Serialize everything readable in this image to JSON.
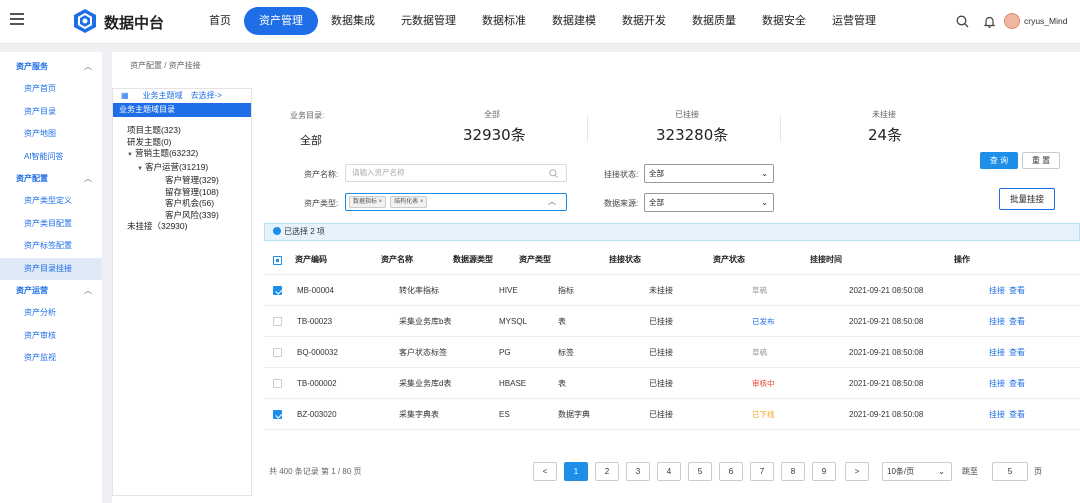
{
  "brand": "数据中台",
  "nav": [
    "首页",
    "资产管理",
    "数据集成",
    "元数据管理",
    "数据标准",
    "数据建模",
    "数据开发",
    "数据质量",
    "数据安全",
    "运营管理"
  ],
  "active_nav": 1,
  "user": "cryus_Mind",
  "sidebar": {
    "groups": [
      {
        "label": "资产服务",
        "items": [
          "资产首页",
          "资产目录",
          "资产地图",
          "AI智能问答"
        ]
      },
      {
        "label": "资产配置",
        "items": [
          "资产类型定义",
          "资产类目配置",
          "资产标签配置",
          "资产目录挂接"
        ]
      },
      {
        "label": "资产运营",
        "items": [
          "资产分析",
          "资产审核",
          "资产监视"
        ]
      }
    ],
    "active_item": "资产目录挂接"
  },
  "breadcrumb": "资产配置 / 资产挂接",
  "tree": {
    "head_label": "业务主题域",
    "head_link": "去选择->",
    "selected": "业务主题域目录",
    "nodes": [
      {
        "label": "项目主题(323)",
        "level": 1,
        "caret": false
      },
      {
        "label": "研发主题(0)",
        "level": 1,
        "caret": false
      },
      {
        "label": "营销主题(63232)",
        "level": 1,
        "caret": true
      },
      {
        "label": "客户运营(31219)",
        "level": 2,
        "caret": true
      },
      {
        "label": "客户管理(329)",
        "level": 4,
        "caret": false
      },
      {
        "label": "留存管理(108)",
        "level": 4,
        "caret": false
      },
      {
        "label": "客户机会(56)",
        "level": 4,
        "caret": false
      },
      {
        "label": "客户风险(339)",
        "level": 4,
        "caret": false
      },
      {
        "label": "未挂接（32930)",
        "level": 1,
        "caret": false
      }
    ]
  },
  "stats": {
    "catalog_label": "业务目录:",
    "catalog_value": "全部",
    "all_label": "全部",
    "all_value": "32930条",
    "linked_label": "已挂接",
    "linked_value": "323280条",
    "unlinked_label": "未挂接",
    "unlinked_value": "24条"
  },
  "filters": {
    "name_label": "资产名称:",
    "name_placeholder": "请输入资产名称",
    "type_label": "资产类型:",
    "type_tags": [
      "数据指标 ×",
      "结构化表 ×"
    ],
    "status_label": "挂接状态:",
    "status_value": "全部",
    "source_label": "数据来源:",
    "source_value": "全部",
    "query_btn": "查 询",
    "reset_btn": "重 置",
    "batch_btn": "批量挂接"
  },
  "selection_text": "已选择 2 项",
  "table": {
    "headers": [
      "资产编码",
      "资产名称",
      "数据源类型",
      "资产类型",
      "挂接状态",
      "资产状态",
      "挂接时间",
      "操作"
    ],
    "rows": [
      {
        "code": "MB-00004",
        "name": "转化率指标",
        "src": "HIVE",
        "type": "指标",
        "link": "未挂接",
        "status": "草稿",
        "status_color": "#999999",
        "time": "2021-09-21  08:50:08",
        "checked": true,
        "op1": "挂接",
        "op2": "查看"
      },
      {
        "code": "TB-00023",
        "name": "采集业务库b表",
        "src": "MYSQL",
        "type": "表",
        "link": "已挂接",
        "status": "已发布",
        "status_color": "#1e6ee8",
        "time": "2021-09-21  08:50:08",
        "checked": false,
        "op1": "挂接",
        "op2": "查看"
      },
      {
        "code": "BQ-000032",
        "name": "客户状态标签",
        "src": "PG",
        "type": "标签",
        "link": "已挂接",
        "status": "草稿",
        "status_color": "#999999",
        "time": "2021-09-21  08:50:08",
        "checked": false,
        "op1": "挂接",
        "op2": "查看"
      },
      {
        "code": "TB-000002",
        "name": "采集业务库d表",
        "src": "HBASE",
        "type": "表",
        "link": "已挂接",
        "status": "审核中",
        "status_color": "#e8443a",
        "time": "2021-09-21  08:50:08",
        "checked": false,
        "op1": "挂接",
        "op2": "查看"
      },
      {
        "code": "BZ-003020",
        "name": "采集字典表",
        "src": "ES",
        "type": "数据字典",
        "link": "已挂接",
        "status": "已下线",
        "status_color": "#f0a020",
        "time": "2021-09-21  08:50:08",
        "checked": true,
        "op1": "挂接",
        "op2": "查看"
      }
    ]
  },
  "pagination": {
    "total_text": "共 400 条记录 第 1 / 80 页",
    "prev": "<",
    "next": ">",
    "pages": [
      "1",
      "2",
      "3",
      "4",
      "5",
      "6",
      "7",
      "8",
      "9"
    ],
    "current": "1",
    "page_size": "10条/页",
    "goto_label": "跳至",
    "goto_value": "5",
    "page_unit": "页"
  },
  "colors": {
    "accent": "#1e6ee8",
    "button": "#1e8fe8"
  }
}
